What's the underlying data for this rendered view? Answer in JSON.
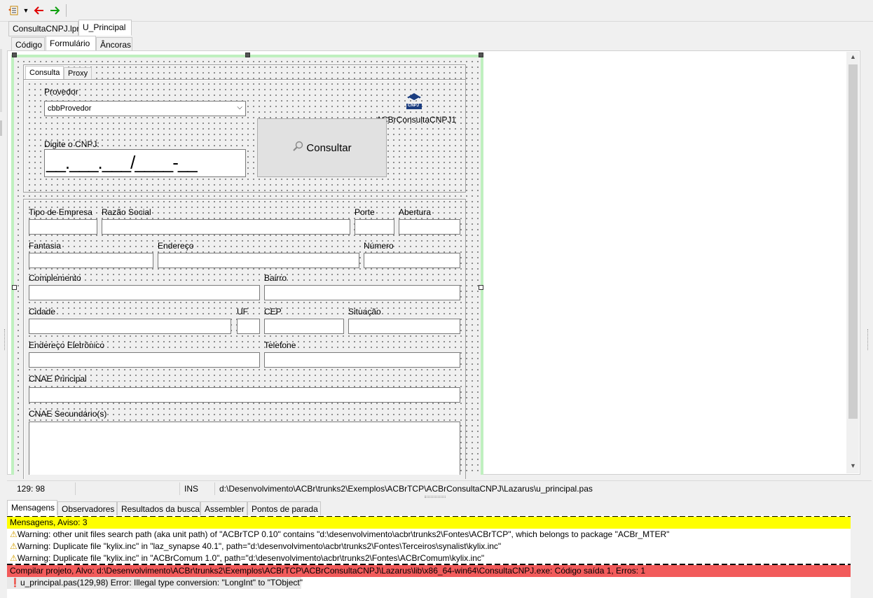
{
  "window": {
    "file_tabs": [
      "ConsultaCNPJ.lpr",
      "U_Principal"
    ],
    "view_tabs": [
      "Código",
      "Formulário",
      "Âncoras"
    ]
  },
  "form": {
    "page_tabs": [
      "Consulta",
      "Proxy"
    ],
    "provedor_label": "Provedor",
    "provedor_value": "cbbProvedor",
    "component_name": "ACBrConsultaCNPJ1",
    "component_icon_text": "CNPJ",
    "cnpj_label": "Digite o CNPJ:",
    "cnpj_mask": "__.___.___/____-__",
    "consultar_label": "Consultar",
    "fields": {
      "tipo_empresa": "Tipo de Empresa",
      "razao_social": "Razão Social",
      "porte": "Porte",
      "abertura": "Abertura",
      "fantasia": "Fantasia",
      "endereco": "Endereço",
      "numero": "Número",
      "complemento": "Complemento",
      "bairro": "Bairro",
      "cidade": "Cidade",
      "uf": "UF",
      "cep": "CEP",
      "situacao": "Situação",
      "endereco_eletronico": "Endereço Eletrônico",
      "telefone": "Telefone",
      "cnae_principal": "CNAE Principal",
      "cnae_secundarios": "CNAE Secundário(s)"
    }
  },
  "status_bar": {
    "position": "129:  98",
    "mode": "INS",
    "path": "d:\\Desenvolvimento\\ACBr\\trunks2\\Exemplos\\ACBrTCP\\ACBrConsultaCNPJ\\Lazarus\\u_principal.pas"
  },
  "bottom_tabs": [
    "Mensagens",
    "Observadores",
    "Resultados da busca",
    "Assembler",
    "Pontos de parada"
  ],
  "messages": {
    "header": "Mensagens, Aviso: 3",
    "warning1": "Warning: other unit files search path (aka unit path) of \"ACBrTCP 0.10\" contains \"d:\\desenvolvimento\\acbr\\trunks2\\Fontes\\ACBrTCP\", which belongs to package \"ACBr_MTER\"",
    "warning2": "Warning: Duplicate file \"kylix.inc\" in \"laz_synapse 40.1\", path=\"d:\\desenvolvimento\\acbr\\trunks2\\Fontes\\Terceiros\\synalist\\kylix.inc\"",
    "warning3": "Warning: Duplicate file \"kylix.inc\" in \"ACBrComum 1.0\", path=\"d:\\desenvolvimento\\acbr\\trunks2\\Fontes\\ACBrComum\\kylix.inc\"",
    "compile": "Compilar projeto, Alvo: d:\\Desenvolvimento\\ACBr\\trunks2\\Exemplos\\ACBrTCP\\ACBrConsultaCNPJ\\Lazarus\\lib\\x86_64-win64\\ConsultaCNPJ.exe: Código saída 1, Erros: 1",
    "error": "u_principal.pas(129,98) Error: Illegal type conversion: \"LongInt\" to \"TObject\""
  },
  "colors": {
    "warning_header_bg": "#ffff00",
    "compile_error_bg": "#f25b5b",
    "form_border": "#bff0bf"
  }
}
